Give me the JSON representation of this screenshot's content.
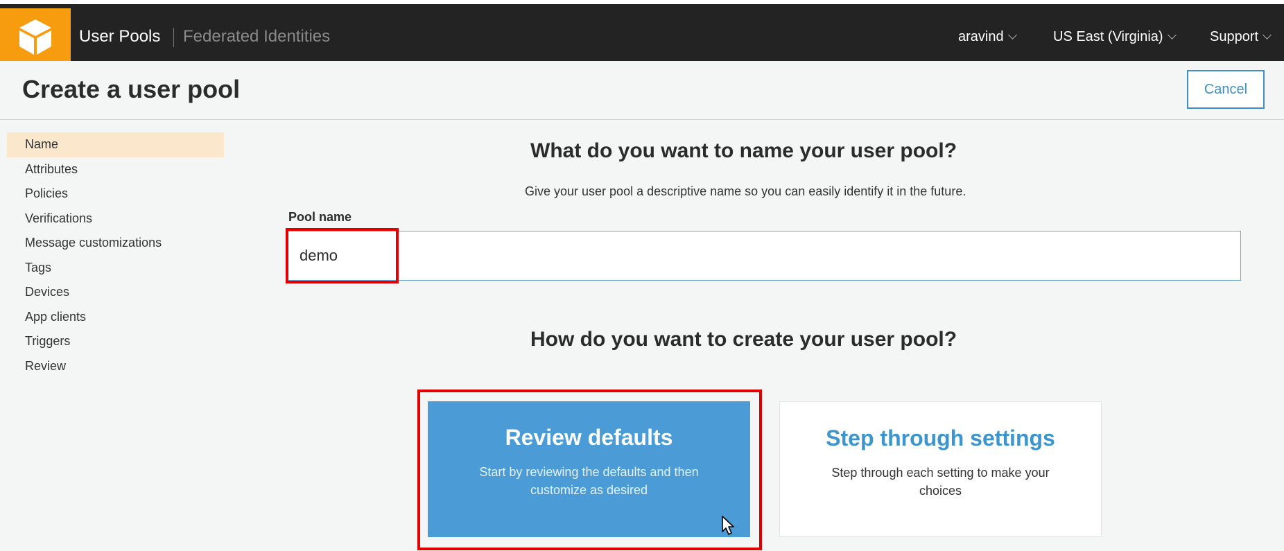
{
  "colors": {
    "topbar_bg": "#232323",
    "logo_bg": "#f79b0f",
    "accent": "#3d8fc6",
    "active_nav_bg": "#fbe8cc",
    "primary_card_bg": "#4a9bd6",
    "highlight": "#e00000"
  },
  "topbar": {
    "logo_icon": "cube-icon",
    "nav": {
      "user_pools": "User Pools",
      "federated": "Federated Identities"
    },
    "user_menu": "aravind",
    "region_menu": "US East (Virginia)",
    "support_menu": "Support"
  },
  "header": {
    "title": "Create a user pool",
    "cancel_label": "Cancel"
  },
  "sidebar": {
    "items": [
      {
        "label": "Name",
        "active": true
      },
      {
        "label": "Attributes"
      },
      {
        "label": "Policies"
      },
      {
        "label": "Verifications"
      },
      {
        "label": "Message customizations"
      },
      {
        "label": "Tags"
      },
      {
        "label": "Devices"
      },
      {
        "label": "App clients"
      },
      {
        "label": "Triggers"
      },
      {
        "label": "Review"
      }
    ]
  },
  "main": {
    "name_heading": "What do you want to name your user pool?",
    "name_description": "Give your user pool a descriptive name so you can easily identify it in the future.",
    "pool_name_label": "Pool name",
    "pool_name_value": "demo",
    "create_heading": "How do you want to create your user pool?",
    "options": {
      "review": {
        "title": "Review defaults",
        "description": "Start by reviewing the defaults and then customize as desired"
      },
      "step": {
        "title": "Step through settings",
        "description": "Step through each setting to make your choices"
      }
    }
  }
}
